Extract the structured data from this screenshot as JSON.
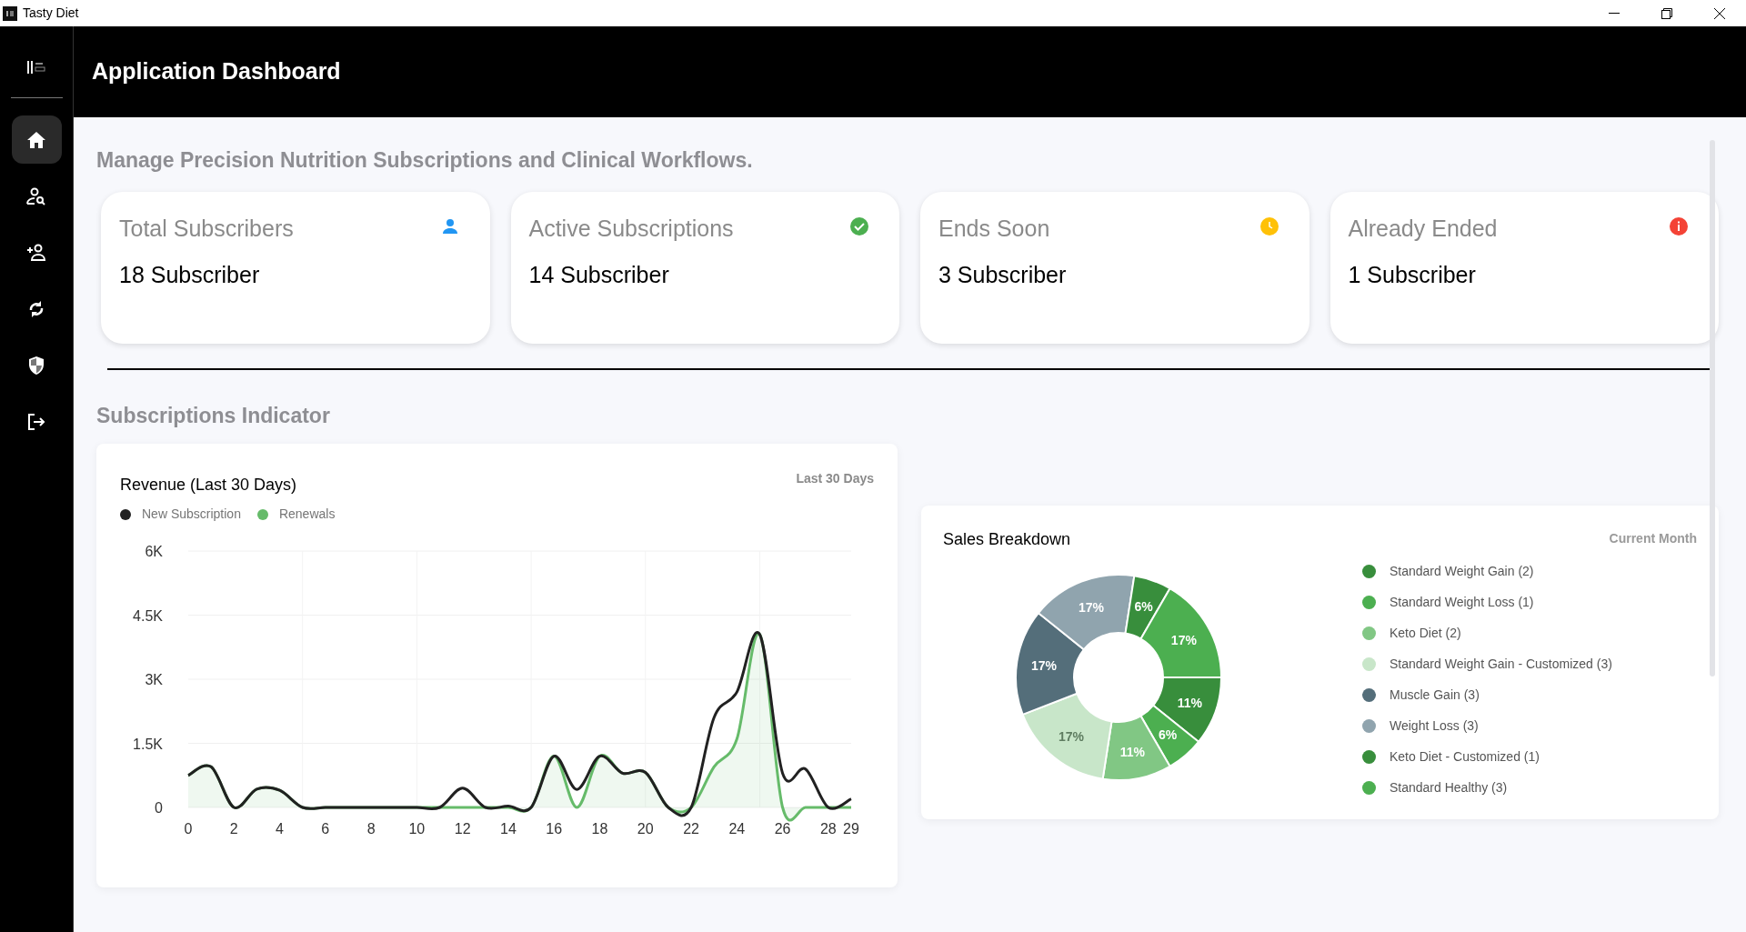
{
  "window": {
    "title": "Tasty Diet"
  },
  "sidebar": {
    "items": [
      {
        "kind": "home",
        "selected": true
      },
      {
        "kind": "user-search",
        "selected": false
      },
      {
        "kind": "user-add",
        "selected": false
      },
      {
        "kind": "refresh",
        "selected": false
      },
      {
        "kind": "shield",
        "selected": false
      },
      {
        "kind": "logout",
        "selected": false
      }
    ]
  },
  "header": {
    "title": "Application Dashboard"
  },
  "subtitle": "Manage Precision Nutrition Subscriptions and Clinical Workflows.",
  "stat_cards": [
    {
      "title": "Total Subscribers",
      "value": "18 Subscriber",
      "kind": "user"
    },
    {
      "title": "Active Subscriptions",
      "value": "14 Subscriber",
      "kind": "check"
    },
    {
      "title": "Ends Soon",
      "value": "3 Subscriber",
      "kind": "clock"
    },
    {
      "title": "Already Ended",
      "value": "1 Subscriber",
      "kind": "alert"
    }
  ],
  "section_title": "Subscriptions Indicator",
  "revenue_card": {
    "badge": "Last 30 Days",
    "chart_data": {
      "type": "line",
      "grid": true,
      "title": "Revenue (Last 30 Days)",
      "x": [
        0,
        1,
        2,
        3,
        4,
        5,
        6,
        7,
        8,
        9,
        10,
        11,
        12,
        13,
        14,
        15,
        16,
        17,
        18,
        19,
        20,
        21,
        22,
        23,
        24,
        25,
        26,
        27,
        28,
        29
      ],
      "series": [
        {
          "name": "New Subscription",
          "type": "line",
          "color": "#212121",
          "values": [
            750,
            950,
            0,
            430,
            400,
            0,
            0,
            0,
            0,
            0,
            0,
            0,
            450,
            0,
            30,
            0,
            1200,
            420,
            1200,
            800,
            820,
            0,
            0,
            2100,
            2700,
            4050,
            800,
            900,
            0,
            200
          ]
        },
        {
          "name": "Renewals",
          "type": "area",
          "color": "#66bb6a",
          "values": [
            750,
            950,
            0,
            430,
            400,
            0,
            0,
            0,
            0,
            0,
            0,
            0,
            0,
            0,
            0,
            0,
            1200,
            0,
            1200,
            800,
            820,
            0,
            0,
            950,
            1600,
            4050,
            0,
            0,
            0,
            0
          ]
        }
      ],
      "xlim": [
        0,
        29
      ],
      "ylim": [
        0,
        6000
      ],
      "xticks": [
        0,
        2,
        4,
        6,
        8,
        10,
        12,
        14,
        16,
        18,
        20,
        22,
        24,
        26,
        28,
        29
      ],
      "yticks": [
        {
          "value": 0,
          "label": "0"
        },
        {
          "value": 1500,
          "label": "1.5K"
        },
        {
          "value": 3000,
          "label": "3K"
        },
        {
          "value": 4500,
          "label": "4.5K"
        },
        {
          "value": 6000,
          "label": "6K"
        }
      ]
    }
  },
  "sales_card": {
    "badge": "Current Month",
    "chart_data": {
      "type": "donut",
      "title": "Sales Breakdown",
      "categories": [
        "Standard Weight Gain (2)",
        "Standard Weight Loss (1)",
        "Keto Diet (2)",
        "Standard Weight Gain - Customized (3)",
        "Muscle Gain (3)",
        "Weight Loss (3)",
        "Keto Diet - Customized (1)",
        "Standard Healthy (3)"
      ],
      "values": [
        11,
        6,
        11,
        17,
        17,
        17,
        6,
        17
      ],
      "colors": [
        "#388e3c",
        "#4caf50",
        "#81c784",
        "#c8e6c9",
        "#546e7a",
        "#90a4ae",
        "#388e3c",
        "#4caf50"
      ],
      "value_labels": [
        "11%",
        "6%",
        "11%",
        "17%",
        "17%",
        "17%",
        "6%",
        "17%"
      ]
    }
  }
}
